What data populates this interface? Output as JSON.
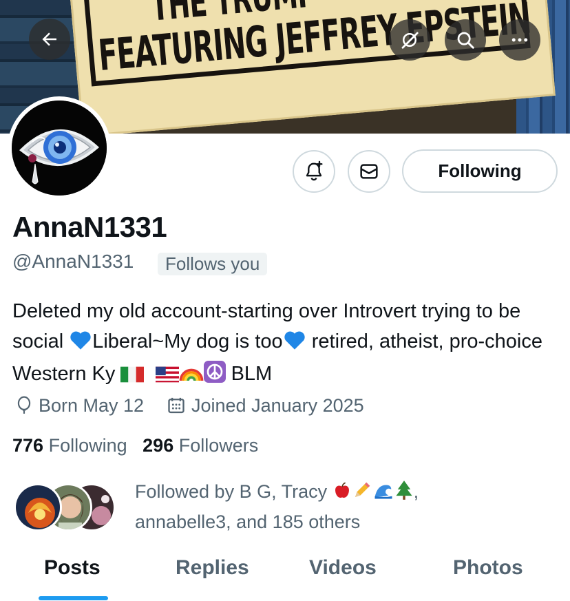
{
  "banner": {
    "line1": "THE TRUMP",
    "line2": "FEATURING JEFFREY EPSTEIN"
  },
  "profile": {
    "display_name": "AnnaN1331",
    "handle": "@AnnaN1331",
    "follows_you_badge": "Follows you",
    "bio": {
      "part1": "Deleted my old account-starting over Introvert trying to be social ",
      "part2": "Liberal~My dog is too",
      "part3": " retired, atheist, pro-choice Western Ky ",
      "part4": " BLM"
    },
    "birthday": "Born May 12",
    "joined": "Joined January 2025",
    "following_count": "776",
    "following_label": "Following",
    "followers_count": "296",
    "followers_label": "Followers",
    "followed_by_text": "Followed by B G, Tracy",
    "followed_by_rest": "annabelle3, and 185 others"
  },
  "actions": {
    "following_button": "Following"
  },
  "tabs": [
    {
      "label": "Posts",
      "active": true
    },
    {
      "label": "Replies",
      "active": false
    },
    {
      "label": "Videos",
      "active": false
    },
    {
      "label": "Photos",
      "active": false
    }
  ],
  "colors": {
    "accent": "#1d9bf0",
    "text_primary": "#0f1419",
    "text_secondary": "#536471",
    "border": "#cfd9de"
  },
  "icons": [
    "back-arrow-icon",
    "grok-icon",
    "search-icon",
    "more-icon",
    "notification-bell-icon",
    "message-icon",
    "balloon-icon",
    "calendar-icon"
  ]
}
